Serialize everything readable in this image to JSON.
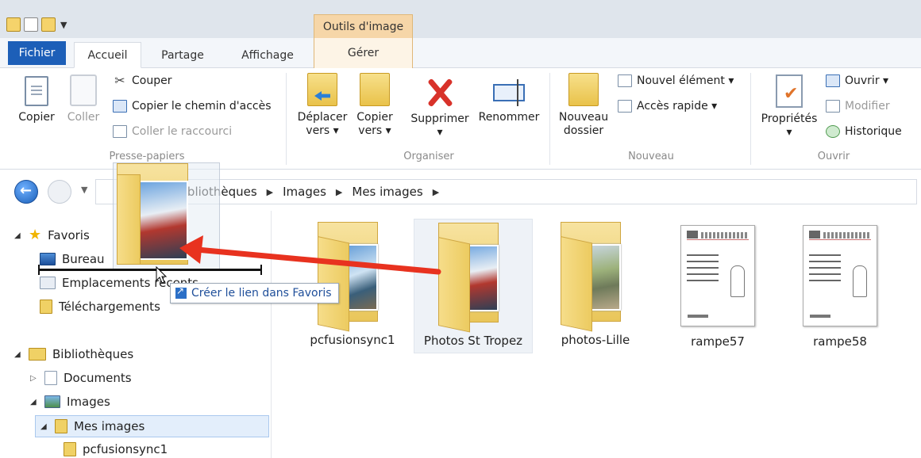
{
  "context_tab": {
    "title": "Outils d'image",
    "tab": "Gérer"
  },
  "tabs": {
    "fichier": "Fichier",
    "accueil": "Accueil",
    "partage": "Partage",
    "affichage": "Affichage"
  },
  "ribbon": {
    "presse_papiers": {
      "label": "Presse-papiers",
      "copier": "Copier",
      "coller": "Coller",
      "couper": "Couper",
      "copier_chemin": "Copier le chemin d'accès",
      "coller_raccourci": "Coller le raccourci"
    },
    "organiser": {
      "label": "Organiser",
      "deplacer_1": "Déplacer",
      "deplacer_2": "vers ▾",
      "copier_1": "Copier",
      "copier_2": "vers ▾",
      "supprimer_1": "Supprimer",
      "supprimer_2": "▾",
      "renommer": "Renommer"
    },
    "nouveau": {
      "label": "Nouveau",
      "nouveau_1": "Nouveau",
      "nouveau_2": "dossier",
      "nouvel_element": "Nouvel élément ▾",
      "acces_rapide": "Accès rapide ▾"
    },
    "ouvrir": {
      "label": "Ouvrir",
      "proprietes_1": "Propriétés",
      "proprietes_2": "▾",
      "ouvrir": "Ouvrir ▾",
      "modifier": "Modifier",
      "historique": "Historique"
    }
  },
  "breadcrumb": [
    "Bibliothèques",
    "Images",
    "Mes images"
  ],
  "nav": {
    "favoris": "Favoris",
    "bureau": "Bureau",
    "emplacements": "Emplacements récents",
    "telechargements": "Téléchargements",
    "bibliotheques": "Bibliothèques",
    "documents": "Documents",
    "images": "Images",
    "mes_images": "Mes images",
    "pcfusionsync1": "pcfusionsync1"
  },
  "files": [
    {
      "name": "pcfusionsync1",
      "kind": "folder"
    },
    {
      "name": "Photos St Tropez",
      "kind": "folder",
      "selected": true
    },
    {
      "name": "photos-Lille",
      "kind": "folder"
    },
    {
      "name": "rampe57",
      "kind": "document"
    },
    {
      "name": "rampe58",
      "kind": "document"
    }
  ],
  "drag": {
    "tooltip": "Créer le lien dans Favoris"
  },
  "colors": {
    "accent": "#1d5fb8",
    "context_tab": "#f6d6a8",
    "drag_arrow": "#e8321f"
  }
}
